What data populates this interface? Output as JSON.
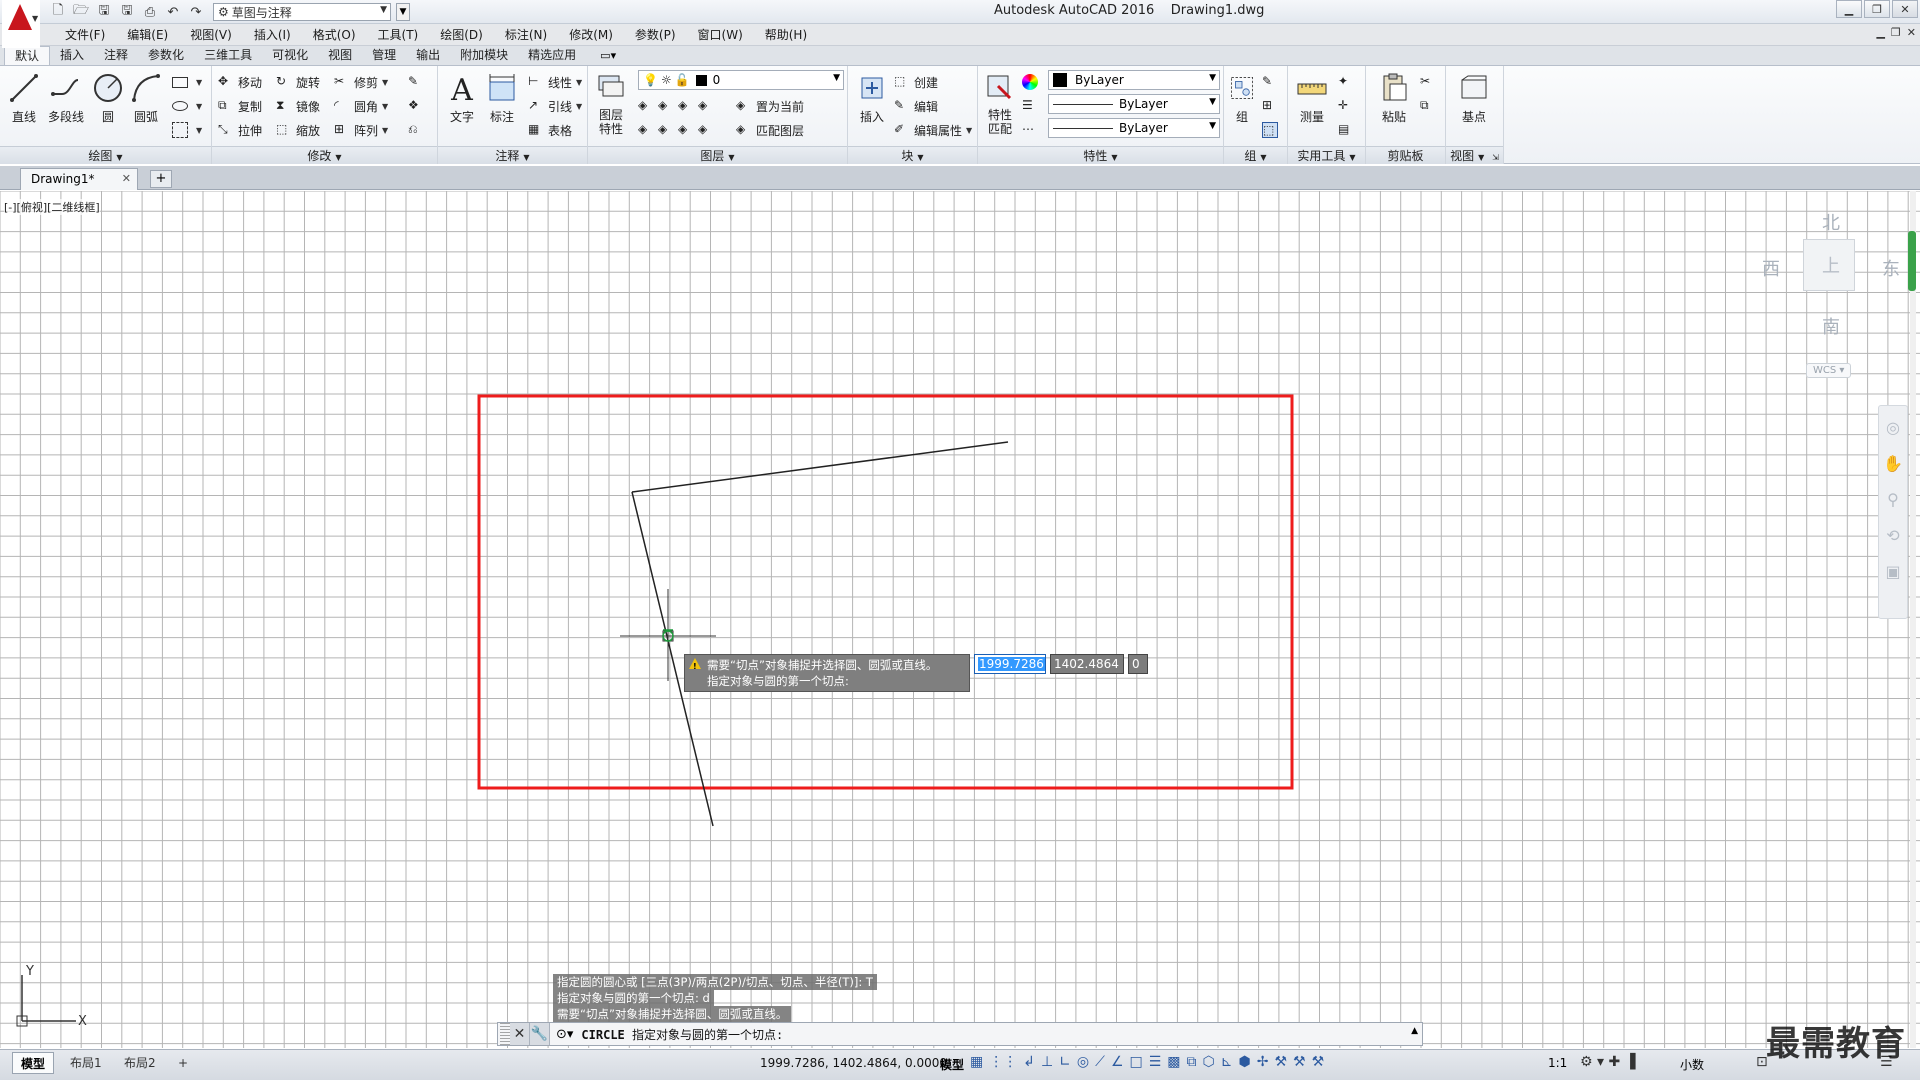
{
  "titlebar": {
    "title": "Autodesk AutoCAD 2016    Drawing1.dwg",
    "workspace": "草图与注释"
  },
  "menubar": {
    "items": [
      "文件(F)",
      "编辑(E)",
      "视图(V)",
      "插入(I)",
      "格式(O)",
      "工具(T)",
      "绘图(D)",
      "标注(N)",
      "修改(M)",
      "参数(P)",
      "窗口(W)",
      "帮助(H)"
    ]
  },
  "ribbon_tabs": [
    "默认",
    "插入",
    "注释",
    "参数化",
    "三维工具",
    "可视化",
    "视图",
    "管理",
    "输出",
    "附加模块",
    "精选应用"
  ],
  "ribbon": {
    "draw": {
      "title": "绘图",
      "line": "直线",
      "polyline": "多段线",
      "circle": "圆",
      "arc": "圆弧"
    },
    "modify": {
      "title": "修改",
      "move": "移动",
      "rotate": "旋转",
      "trim": "修剪",
      "copy": "复制",
      "mirror": "镜像",
      "fillet": "圆角",
      "stretch": "拉伸",
      "scale": "缩放",
      "array": "阵列"
    },
    "annotation": {
      "title": "注释",
      "text": "文字",
      "dimension": "标注",
      "linear": "线性",
      "leader": "引线",
      "table": "表格"
    },
    "layers": {
      "title": "图层",
      "layer_props": "图层\n特性",
      "current_layer": "0",
      "set_current": "置为当前",
      "match_layer": "匹配图层"
    },
    "block": {
      "title": "块",
      "insert": "插入",
      "create": "创建",
      "edit": "编辑",
      "edit_attr": "编辑属性"
    },
    "properties": {
      "title": "特性",
      "match": "特性\n匹配",
      "color": "ByLayer",
      "linetype": "ByLayer",
      "lineweight": "ByLayer"
    },
    "groups": {
      "title": "组",
      "group": "组"
    },
    "utilities": {
      "title": "实用工具",
      "measure": "测量"
    },
    "clipboard": {
      "title": "剪贴板",
      "paste": "粘贴"
    },
    "view": {
      "title": "视图",
      "base": "基点"
    }
  },
  "doc_tab": {
    "name": "Drawing1*"
  },
  "viewport_label": "[-][俯视][二维线框]",
  "viewcube": {
    "north": "北",
    "south": "南",
    "east": "东",
    "west": "西",
    "top": "上",
    "wcs": "WCS"
  },
  "dynamic_input": {
    "message_line1": "需要“切点”对象捕捉并选择圆、圆弧或直线。",
    "message_line2": "指定对象与圆的第一个切点:",
    "x": "1999.7286",
    "y": "1402.4864",
    "z": "0"
  },
  "command_history": [
    "指定圆的圆心或 [三点(3P)/两点(2P)/切点、切点、半径(T)]: T",
    "指定对象与圆的第一个切点:  d",
    "需要“切点”对象捕捉并选择圆、圆弧或直线。"
  ],
  "command_line": {
    "command": "CIRCLE",
    "prompt": "指定对象与圆的第一个切点:"
  },
  "layout_tabs": [
    "模型",
    "布局1",
    "布局2"
  ],
  "statusbar": {
    "coords": "1999.7286, 1402.4864, 0.0000",
    "model": "模型",
    "scale": "1:1",
    "units": "小数"
  },
  "watermark": "最需教育",
  "colors": {
    "highlight_rect": "#ee1c1c",
    "grid": "#b5b5b5",
    "accent": "#c8161d"
  }
}
